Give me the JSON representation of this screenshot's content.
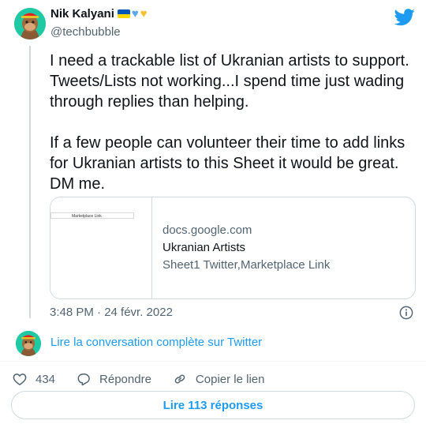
{
  "author": {
    "name": "Nik Kalyani",
    "handle": "@techbubble",
    "badges": [
      "ukraine-flag-icon",
      "blue-heart-icon",
      "yellow-heart-icon"
    ]
  },
  "tweet": {
    "paragraph1": "I need a trackable list of Ukranian artists to support. Tweets/Lists not working...I spend time just wading through replies than helping.",
    "paragraph2": "If a few people can volunteer their time to add links for Ukranian artists to this Sheet it would be great. DM me.",
    "timestamp": "3:48 PM · 24 févr. 2022"
  },
  "card": {
    "domain": "docs.google.com",
    "title": "Ukranian Artists",
    "description": "Sheet1 Twitter,Marketplace Link",
    "thumb_text": "Marketplace Link"
  },
  "thread": {
    "read_full": "Lire la conversation complète sur Twitter"
  },
  "actions": {
    "likes": "434",
    "reply_label": "Répondre",
    "copy_label": "Copier le lien",
    "replies_button": "Lire 113 réponses"
  },
  "colors": {
    "accent": "#1d9bf0",
    "text": "#0f1419",
    "muted": "#536471",
    "border": "#cfd9de"
  }
}
